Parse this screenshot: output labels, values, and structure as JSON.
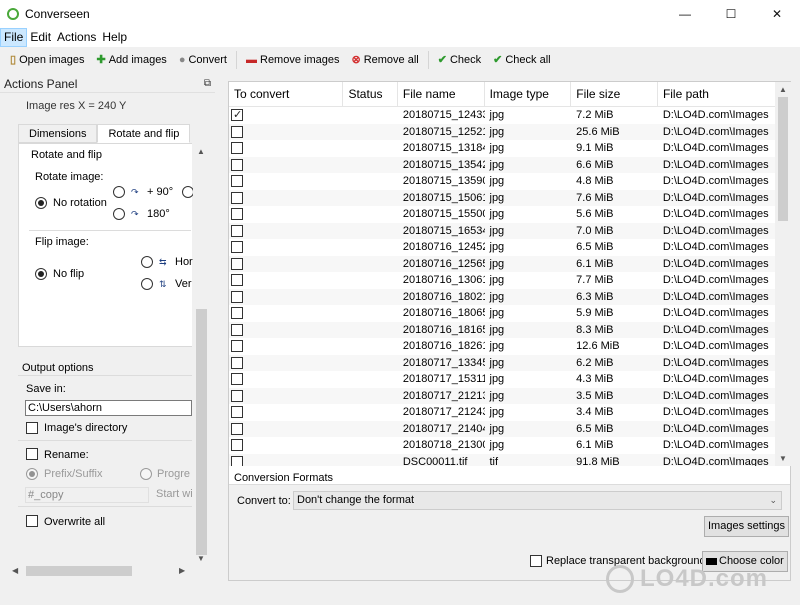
{
  "window": {
    "title": "Converseen",
    "minimize": "—",
    "maximize": "☐",
    "close": "✕"
  },
  "menu": [
    "File",
    "Edit",
    "Actions",
    "Help"
  ],
  "toolbar": {
    "open": "Open images",
    "add": "Add images",
    "convert": "Convert",
    "remove": "Remove images",
    "remove_all": "Remove all",
    "check": "Check",
    "check_all": "Check all"
  },
  "actions_panel": {
    "title": "Actions Panel",
    "image_res": "Image res  X = 240 Y",
    "tabs": [
      "Dimensions",
      "Rotate and flip"
    ],
    "rotate_flip": {
      "group": "Rotate and flip",
      "rotate_label": "Rotate image:",
      "no_rotation": "No rotation",
      "plus90": "+ 90°",
      "r180": "180°",
      "flip_label": "Flip image:",
      "no_flip": "No flip",
      "hor": "Hor",
      "ver": "Ver"
    },
    "output": {
      "title": "Output options",
      "save_in": "Save in:",
      "path": "C:\\Users\\ahorn",
      "image_dir": "Image's directory",
      "rename": "Rename:",
      "prefix_suffix": "Prefix/Suffix",
      "progressive": "Progre",
      "prefix_value": "#_copy",
      "start": "Start wi",
      "overwrite": "Overwrite all"
    }
  },
  "table": {
    "headers": [
      "To convert",
      "Status",
      "File name",
      "Image type",
      "File size",
      "File path"
    ],
    "rows": [
      {
        "checked": true,
        "name": "20180715_12433...",
        "type": "jpg",
        "size": "7.2 MiB",
        "path": "D:\\LO4D.com\\Images"
      },
      {
        "checked": false,
        "name": "20180715_12521...",
        "type": "jpg",
        "size": "25.6 MiB",
        "path": "D:\\LO4D.com\\Images"
      },
      {
        "checked": false,
        "name": "20180715_13184...",
        "type": "jpg",
        "size": "9.1 MiB",
        "path": "D:\\LO4D.com\\Images"
      },
      {
        "checked": false,
        "name": "20180715_13542...",
        "type": "jpg",
        "size": "6.6 MiB",
        "path": "D:\\LO4D.com\\Images"
      },
      {
        "checked": false,
        "name": "20180715_13590...",
        "type": "jpg",
        "size": "4.8 MiB",
        "path": "D:\\LO4D.com\\Images"
      },
      {
        "checked": false,
        "name": "20180715_15061...",
        "type": "jpg",
        "size": "7.6 MiB",
        "path": "D:\\LO4D.com\\Images"
      },
      {
        "checked": false,
        "name": "20180715_15500...",
        "type": "jpg",
        "size": "5.6 MiB",
        "path": "D:\\LO4D.com\\Images"
      },
      {
        "checked": false,
        "name": "20180715_16534...",
        "type": "jpg",
        "size": "7.0 MiB",
        "path": "D:\\LO4D.com\\Images"
      },
      {
        "checked": false,
        "name": "20180716_12452...",
        "type": "jpg",
        "size": "6.5 MiB",
        "path": "D:\\LO4D.com\\Images"
      },
      {
        "checked": false,
        "name": "20180716_12565...",
        "type": "jpg",
        "size": "6.1 MiB",
        "path": "D:\\LO4D.com\\Images"
      },
      {
        "checked": false,
        "name": "20180716_13061...",
        "type": "jpg",
        "size": "7.7 MiB",
        "path": "D:\\LO4D.com\\Images"
      },
      {
        "checked": false,
        "name": "20180716_18021...",
        "type": "jpg",
        "size": "6.3 MiB",
        "path": "D:\\LO4D.com\\Images"
      },
      {
        "checked": false,
        "name": "20180716_18065...",
        "type": "jpg",
        "size": "5.9 MiB",
        "path": "D:\\LO4D.com\\Images"
      },
      {
        "checked": false,
        "name": "20180716_18165...",
        "type": "jpg",
        "size": "8.3 MiB",
        "path": "D:\\LO4D.com\\Images"
      },
      {
        "checked": false,
        "name": "20180716_18261...",
        "type": "jpg",
        "size": "12.6 MiB",
        "path": "D:\\LO4D.com\\Images"
      },
      {
        "checked": false,
        "name": "20180717_13345...",
        "type": "jpg",
        "size": "6.2 MiB",
        "path": "D:\\LO4D.com\\Images"
      },
      {
        "checked": false,
        "name": "20180717_15311...",
        "type": "jpg",
        "size": "4.3 MiB",
        "path": "D:\\LO4D.com\\Images"
      },
      {
        "checked": false,
        "name": "20180717_21213...",
        "type": "jpg",
        "size": "3.5 MiB",
        "path": "D:\\LO4D.com\\Images"
      },
      {
        "checked": false,
        "name": "20180717_21243...",
        "type": "jpg",
        "size": "3.4 MiB",
        "path": "D:\\LO4D.com\\Images"
      },
      {
        "checked": false,
        "name": "20180717_21404...",
        "type": "jpg",
        "size": "6.5 MiB",
        "path": "D:\\LO4D.com\\Images"
      },
      {
        "checked": false,
        "name": "20180718_21300...",
        "type": "jpg",
        "size": "6.1 MiB",
        "path": "D:\\LO4D.com\\Images"
      },
      {
        "checked": false,
        "name": "DSC00011.tif",
        "type": "tif",
        "size": "91.8 MiB",
        "path": "D:\\LO4D.com\\Images"
      }
    ]
  },
  "formats": {
    "title": "Conversion Formats",
    "convert_to": "Convert to:",
    "selected": "Don't change the format",
    "image_settings": "Images settings",
    "replace_bg": "Replace transparent background",
    "choose_color": "Choose color"
  },
  "watermark": "LO4D.com"
}
